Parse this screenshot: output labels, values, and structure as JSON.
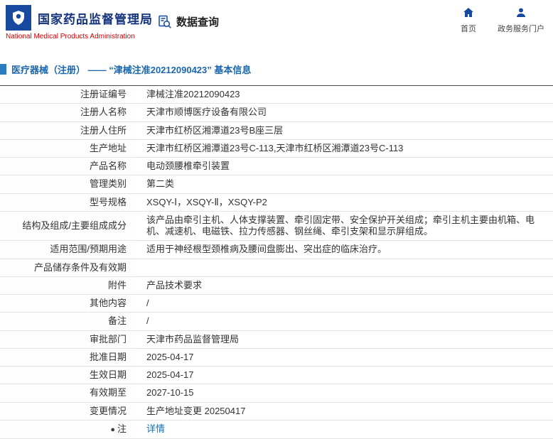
{
  "header": {
    "logo_title": "国家药品监督管理局",
    "logo_subtitle": "National Medical Products Administration",
    "data_query_label": "数据查询",
    "home_label": "首页",
    "portal_label": "政务服务门户"
  },
  "breadcrumb": {
    "title": "医疗器械（注册） —— “津械注准20212090423” 基本信息"
  },
  "icons": {
    "emblem": "nmpa-emblem-icon",
    "data_query": "document-search-icon",
    "home": "home-icon",
    "portal": "user-icon",
    "note": "note-dot-icon"
  },
  "colors": {
    "brand_blue": "#17499e",
    "brand_dark_blue": "#16337e",
    "brand_red": "#d40000",
    "breadcrumb_blue": "#1b66ad",
    "link_blue": "#0d6fb8"
  },
  "table": {
    "rows": [
      {
        "label": "注册证编号",
        "value": "津械注准20212090423"
      },
      {
        "label": "注册人名称",
        "value": "天津市顺博医疗设备有限公司"
      },
      {
        "label": "注册人住所",
        "value": "天津市红桥区湘潭道23号B座三层"
      },
      {
        "label": "生产地址",
        "value": "天津市红桥区湘潭道23号C-113,天津市红桥区湘潭道23号C-113"
      },
      {
        "label": "产品名称",
        "value": "电动颈腰椎牵引装置"
      },
      {
        "label": "管理类别",
        "value": "第二类"
      },
      {
        "label": "型号规格",
        "value": "XSQY-Ⅰ，XSQY-Ⅱ，XSQY-P2"
      },
      {
        "label": "结构及组成/主要组成成分",
        "value": "该产品由牵引主机、人体支撑装置、牵引固定带、安全保护开关组成；牵引主机主要由机箱、电机、减速机、电磁铁、拉力传感器、钢丝绳、牵引支架和显示屏组成。"
      },
      {
        "label": "适用范围/预期用途",
        "value": "适用于神经根型颈椎病及腰间盘膨出、突出症的临床治疗。"
      },
      {
        "label": "产品储存条件及有效期",
        "value": ""
      },
      {
        "label": "附件",
        "value": "产品技术要求"
      },
      {
        "label": "其他内容",
        "value": "/"
      },
      {
        "label": "备注",
        "value": "/"
      },
      {
        "label": "审批部门",
        "value": "天津市药品监督管理局"
      },
      {
        "label": "批准日期",
        "value": "2025-04-17"
      },
      {
        "label": "生效日期",
        "value": "2025-04-17"
      },
      {
        "label": "有效期至",
        "value": "2027-10-15"
      },
      {
        "label": "变更情况",
        "value": "生产地址变更 20250417"
      },
      {
        "label": "注",
        "value": "详情",
        "link": true,
        "icon": "note-dot-icon"
      }
    ]
  }
}
